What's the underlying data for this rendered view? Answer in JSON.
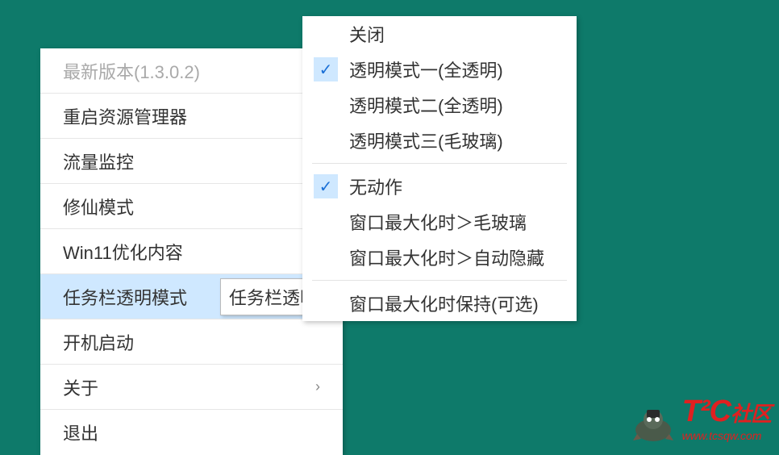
{
  "mainMenu": {
    "title": "最新版本(1.3.0.2)",
    "items": [
      {
        "label": "重启资源管理器",
        "arrow": false
      },
      {
        "label": "流量监控",
        "arrow": true
      },
      {
        "label": "修仙模式",
        "arrow": true
      },
      {
        "label": "Win11优化内容",
        "arrow": false
      },
      {
        "label": "任务栏透明模式",
        "arrow": false,
        "selected": true,
        "tooltip": "任务栏透明模"
      },
      {
        "label": "开机启动",
        "arrow": false
      },
      {
        "label": "关于",
        "arrow": true
      },
      {
        "label": "退出",
        "arrow": false
      }
    ]
  },
  "subMenu": {
    "group1": [
      {
        "label": "关闭",
        "checked": false
      },
      {
        "label": "透明模式一(全透明)",
        "checked": true
      },
      {
        "label": "透明模式二(全透明)",
        "checked": false
      },
      {
        "label": "透明模式三(毛玻璃)",
        "checked": false
      }
    ],
    "group2": [
      {
        "label": "无动作",
        "checked": true
      },
      {
        "label": "窗口最大化时＞毛玻璃",
        "checked": false
      },
      {
        "label": "窗口最大化时＞自动隐藏",
        "checked": false
      }
    ],
    "group3": [
      {
        "label": "窗口最大化时保持(可选)",
        "checked": false
      }
    ]
  },
  "watermark": {
    "brand": "T²C",
    "brandSuffix": "社区",
    "url": "www.tcsqw.com"
  }
}
